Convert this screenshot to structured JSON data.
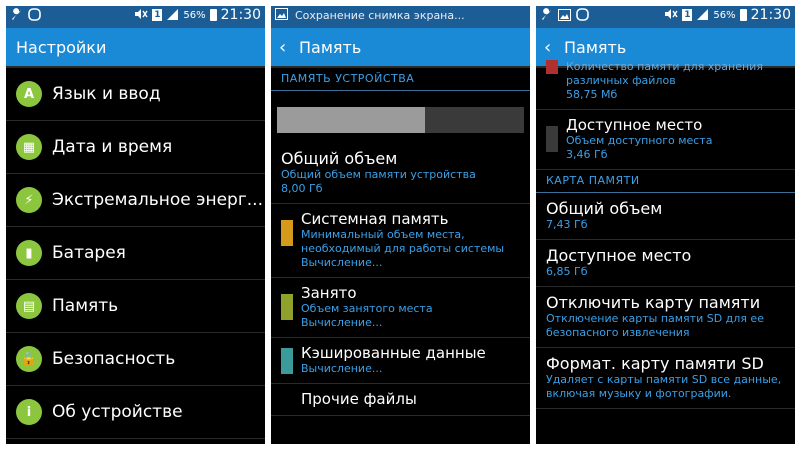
{
  "status_left": {
    "battery_pct": "56%",
    "time": "21:30"
  },
  "status_mid": {
    "battery_pct": "",
    "time": "",
    "notification": "Сохранение снимка экрана..."
  },
  "status_right": {
    "battery_pct": "56%",
    "time": "21:30"
  },
  "settings_panel": {
    "title": "Настройки",
    "items": [
      {
        "label": "Язык и ввод",
        "icon": "language-icon",
        "glyph": "A"
      },
      {
        "label": "Дата и время",
        "icon": "calendar-icon",
        "glyph": "▦"
      },
      {
        "label": "Экстремальное энерг...",
        "icon": "power-saving-icon",
        "glyph": "⚡"
      },
      {
        "label": "Батарея",
        "icon": "battery-icon",
        "glyph": "▮"
      },
      {
        "label": "Память",
        "icon": "memory-icon",
        "glyph": "▤"
      },
      {
        "label": "Безопасность",
        "icon": "lock-icon",
        "glyph": "🔒"
      },
      {
        "label": "Об устройстве",
        "icon": "info-icon",
        "glyph": "i"
      }
    ]
  },
  "memory_panel": {
    "back_title": "Память",
    "section_title": "ПАМЯТЬ УСТРОЙСТВА",
    "used_fraction": 0.6,
    "total": {
      "title": "Общий объем",
      "sub1": "Общий объем памяти устройства",
      "sub2": "8,00 Гб"
    },
    "system": {
      "title": "Системная память",
      "sub1": "Минимальный объем места,",
      "sub2": "необходимый для работы системы",
      "sub3": "Вычисление...",
      "color": "#d69a1a"
    },
    "used": {
      "title": "Занято",
      "sub1": "Объем занятого места",
      "sub2": "Вычисление...",
      "color": "#8fa12a"
    },
    "cached": {
      "title": "Кэшированные данные",
      "sub1": "Вычисление...",
      "color": "#3d9a9a"
    },
    "other": {
      "title": "Прочие файлы"
    }
  },
  "memory_panel_scrolled": {
    "back_title": "Память",
    "top_partial": {
      "sub1": "Количество памяти для хранения",
      "sub2": "различных файлов",
      "sub3": "58,75 Мб",
      "color": "#b03030"
    },
    "available": {
      "title": "Доступное место",
      "sub1": "Объем доступного места",
      "sub2": "3,46 Гб",
      "color": "#3a3a3a"
    },
    "sd_section_title": "КАРТА ПАМЯТИ",
    "sd_total": {
      "title": "Общий объем",
      "sub1": "7,43 Гб"
    },
    "sd_available": {
      "title": "Доступное место",
      "sub1": "6,85 Гб"
    },
    "unmount": {
      "title": "Отключить карту памяти",
      "sub1": "Отключение карты памяти SD для ее",
      "sub2": "безопасного извлечения"
    },
    "format": {
      "title": "Формат. карту памяти SD",
      "sub1": "Удаляет с карты памяти SD все данные,",
      "sub2": "включая музыку и фотографии."
    }
  }
}
